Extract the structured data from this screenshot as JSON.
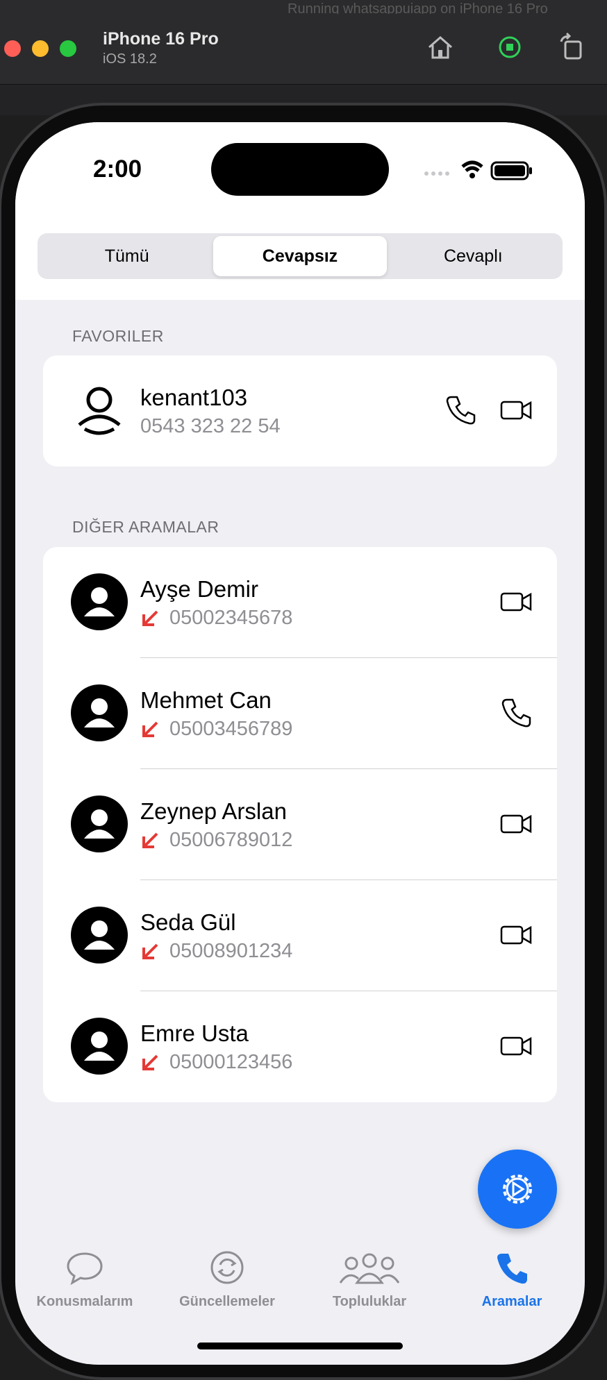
{
  "simulator": {
    "title": "iPhone 16 Pro",
    "subtitle": "iOS 18.2",
    "running": "Running whatsappuiapp on iPhone 16 Pro"
  },
  "status_bar": {
    "time": "2:00"
  },
  "segments": {
    "all": "Tümü",
    "missed": "Cevapsız",
    "answered": "Cevaplı",
    "selected": "Cevapsız"
  },
  "favorites": {
    "header": "FAVORILER",
    "items": [
      {
        "name": "kenant103",
        "phone": "0543 323 22 54"
      }
    ]
  },
  "other_calls": {
    "header": "DIĞER ARAMALAR",
    "items": [
      {
        "name": "Ayşe Demir",
        "phone": "05002345678",
        "call_type": "video",
        "status": "missed"
      },
      {
        "name": "Mehmet Can",
        "phone": "05003456789",
        "call_type": "voice",
        "status": "missed"
      },
      {
        "name": "Zeynep Arslan",
        "phone": "05006789012",
        "call_type": "video",
        "status": "missed"
      },
      {
        "name": "Seda Gül",
        "phone": "05008901234",
        "call_type": "video",
        "status": "missed"
      },
      {
        "name": "Emre Usta",
        "phone": "05000123456",
        "call_type": "video",
        "status": "missed"
      }
    ]
  },
  "tabbar": {
    "chats": "Konusmalarım",
    "updates": "Güncellemeler",
    "communities": "Topluluklar",
    "calls": "Aramalar",
    "active": "Aramalar"
  },
  "colors": {
    "accent": "#1a73e8",
    "missed": "#e53935",
    "fab": "#1972f5"
  }
}
